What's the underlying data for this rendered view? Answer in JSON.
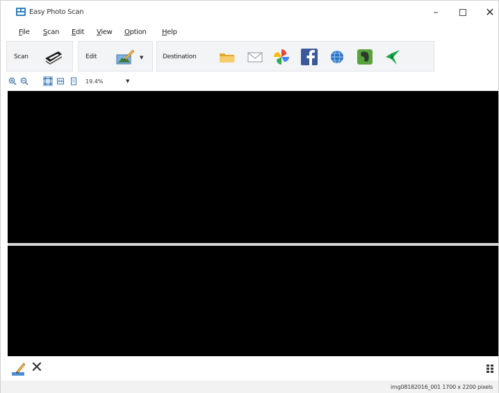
{
  "window": {
    "title": "Easy Photo Scan",
    "controls": {
      "minimize": "–",
      "close": "✕"
    }
  },
  "menu": {
    "items": [
      {
        "mnemonic": "F",
        "rest": "ile"
      },
      {
        "mnemonic": "S",
        "rest": "can"
      },
      {
        "mnemonic": "E",
        "rest": "dit"
      },
      {
        "mnemonic": "V",
        "rest": "iew"
      },
      {
        "mnemonic": "O",
        "rest": "ption"
      },
      {
        "mnemonic": "H",
        "rest": "elp"
      }
    ]
  },
  "toolbar": {
    "scan_label": "Scan",
    "edit_label": "Edit",
    "destination_label": "Destination",
    "destinations": [
      "folder-icon",
      "email-icon",
      "photos-pinwheel-icon",
      "facebook-icon",
      "web-globe-icon",
      "evernote-icon",
      "other-destination-icon"
    ],
    "dropdown_arrow": "▼"
  },
  "zoom": {
    "value": "19.4%",
    "arrow": "▼"
  },
  "status": {
    "text": "img08182016_001 1700 x 2200 pixels"
  },
  "bottom": {
    "delete_glyph": "✕"
  },
  "colors": {
    "preview_bg": "#000000",
    "toolbar_bg": "#f3f4f6",
    "facebook": "#3b5998",
    "folder": "#f2c14e",
    "evernote": "#58a33b"
  }
}
